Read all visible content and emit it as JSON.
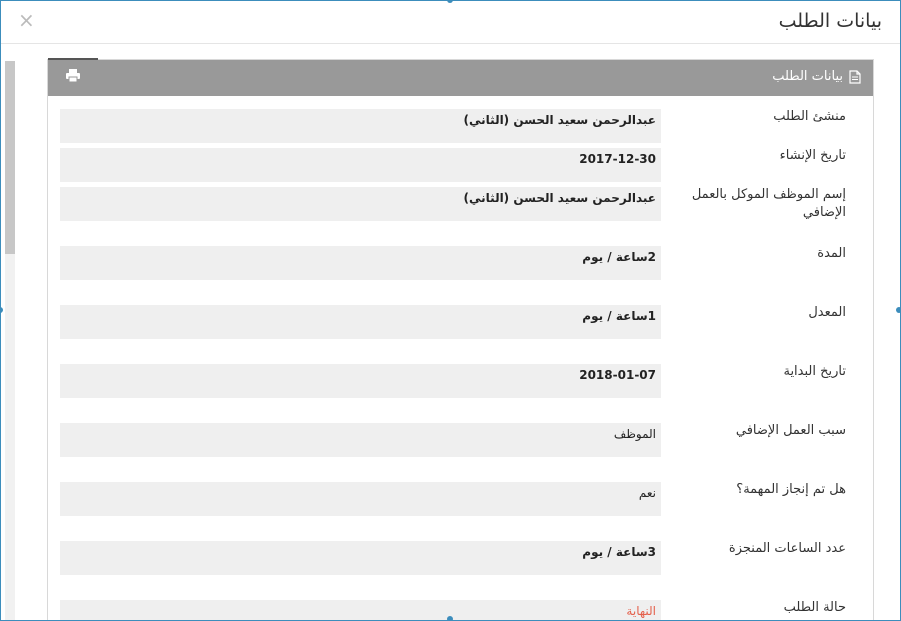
{
  "header": {
    "title": "بيانات الطلب",
    "close_glyph": "×"
  },
  "panel": {
    "title": "بيانات الطلب",
    "title_icon": "file-icon",
    "print_icon": "print-icon"
  },
  "fields": [
    {
      "label": "منشئ الطلب",
      "value": "عبدالرحمن سعيد الحسن (الثاني)"
    },
    {
      "label": "تاريخ الإنشاء",
      "value": "2017-12-30"
    },
    {
      "label": "إسم الموظف الموكل بالعمل الإضافي",
      "value": "عبدالرحمن سعيد الحسن (الثاني)"
    },
    {
      "label": "المدة",
      "value": "2ساعة / يوم"
    },
    {
      "label": "المعدل",
      "value": "1ساعة / يوم"
    },
    {
      "label": "تاريخ البداية",
      "value": "2018-01-07"
    },
    {
      "label": "سبب العمل الإضافي",
      "value": "الموظف"
    },
    {
      "label": "هل تم إنجاز المهمة؟",
      "value": "نعم"
    },
    {
      "label": "عدد الساعات المنجزة",
      "value": "3ساعة / يوم"
    },
    {
      "label": "حالة الطلب",
      "value": "النهاية"
    }
  ],
  "colors": {
    "border_accent": "#3c8dbc",
    "panel_header": "#999999",
    "value_bg": "#efefef",
    "status_color": "#e4604b"
  }
}
